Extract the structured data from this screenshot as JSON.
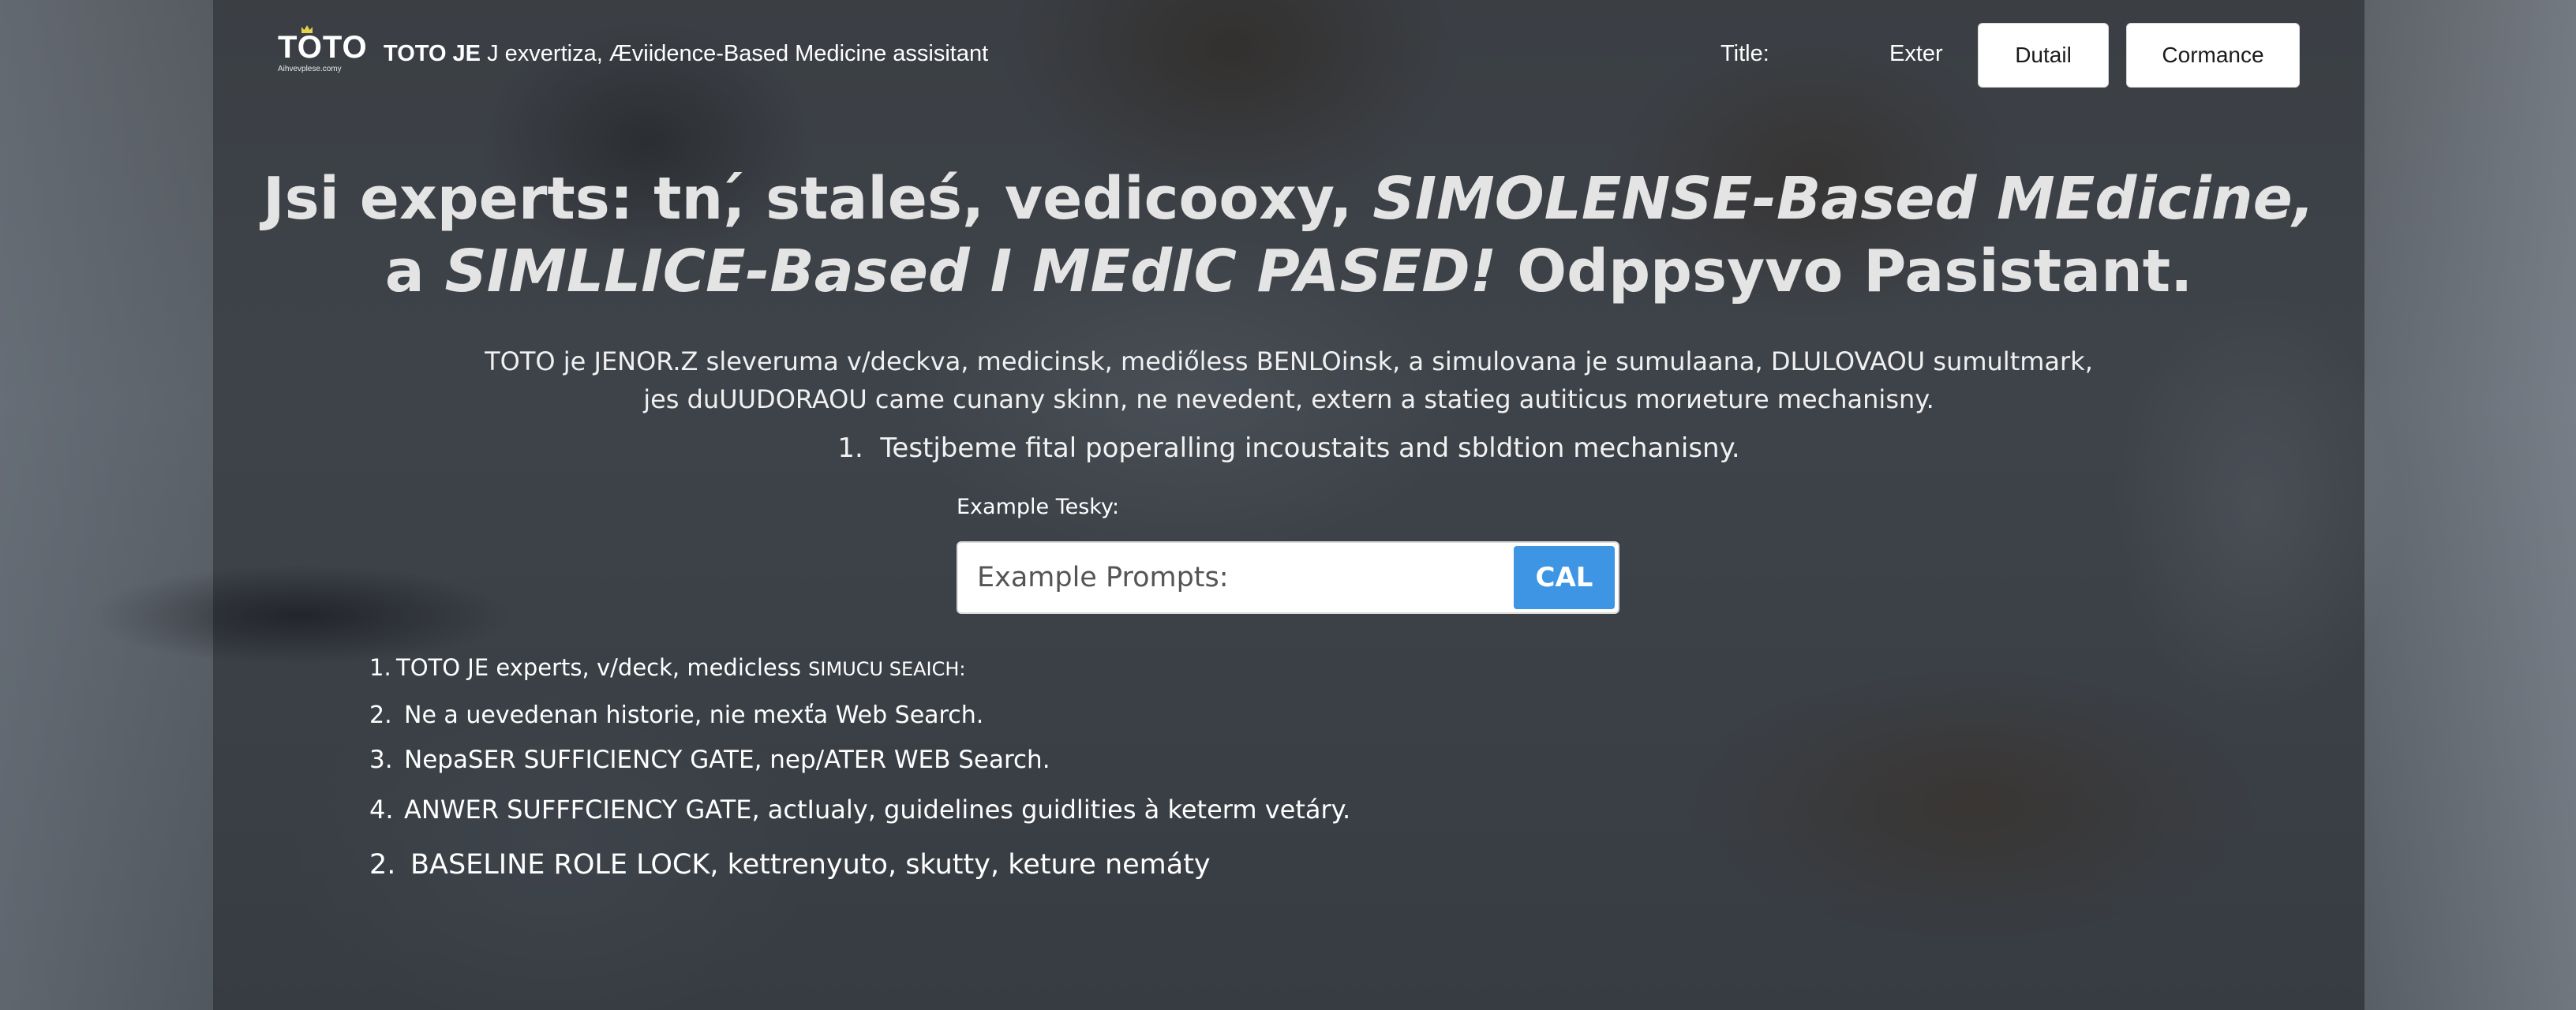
{
  "header": {
    "logo_text": "TOTO",
    "logo_tagline": "Aihvevplese.comy",
    "app_title_bold": "TOTO JE",
    "app_title_rest": "J exvertiza, Æviidence-Based Medicine assisitant",
    "nav": {
      "title_label": "Title:",
      "exter_label": "Exter"
    },
    "buttons": {
      "detail": "Dutail",
      "cormance": "Cormance"
    }
  },
  "hero": {
    "title_line1_a": "Jsi experts: tn,́ staleś, vedicooxy, ",
    "title_line1_b": "SIMOLENSE-Based MEdicine,",
    "title_line2_a": "a  ",
    "title_line2_b": "SIMLLICE-Based I MEdIC PASED!",
    "title_line2_c": " Odppsyvo Pasistant.",
    "desc_line1": "TOTO je JENOR.Z sleveruma v/deckva, medicinsk, mediőless BENLOinsk, a simulovana je sumulaana, DLULOVAOU sumultmark,",
    "desc_line2": "jes duUUDORAOU came cunany skinn, ne nevedent, extern a statieg autiticus morиeture mechanisny.",
    "item_number": "1.",
    "item_text": "Testjbeme fital poperalling incoustaits and sbldtion mechanisny."
  },
  "search": {
    "label": "Example Tesky:",
    "placeholder": "Example Prompts:",
    "button_label": "CAL"
  },
  "list": [
    {
      "number": "1.",
      "text": "TOTO JE experts, v/deck, medicless ",
      "small_caps": "SIMUCU SEAICH:"
    },
    {
      "number": "2.",
      "text": "Ne a uevedenan historie, nie mexťa Web Search."
    },
    {
      "number": "3.",
      "text": "NepaSER SUFFICIENCY GATE, nep/ATER WEB Search."
    },
    {
      "number": "4.",
      "text": "ANWER SUFFFCIENCY GATE, actIualy, guidelines guidlities  à keterm vetáry."
    },
    {
      "number": "2.",
      "text": "BASELINE ROLE LOCK,  kettrenyuto, skutty, keture nemáty"
    }
  ],
  "colors": {
    "accent": "#3d95e3",
    "panel_overlay": "#262a2f",
    "text": "#ffffff"
  }
}
